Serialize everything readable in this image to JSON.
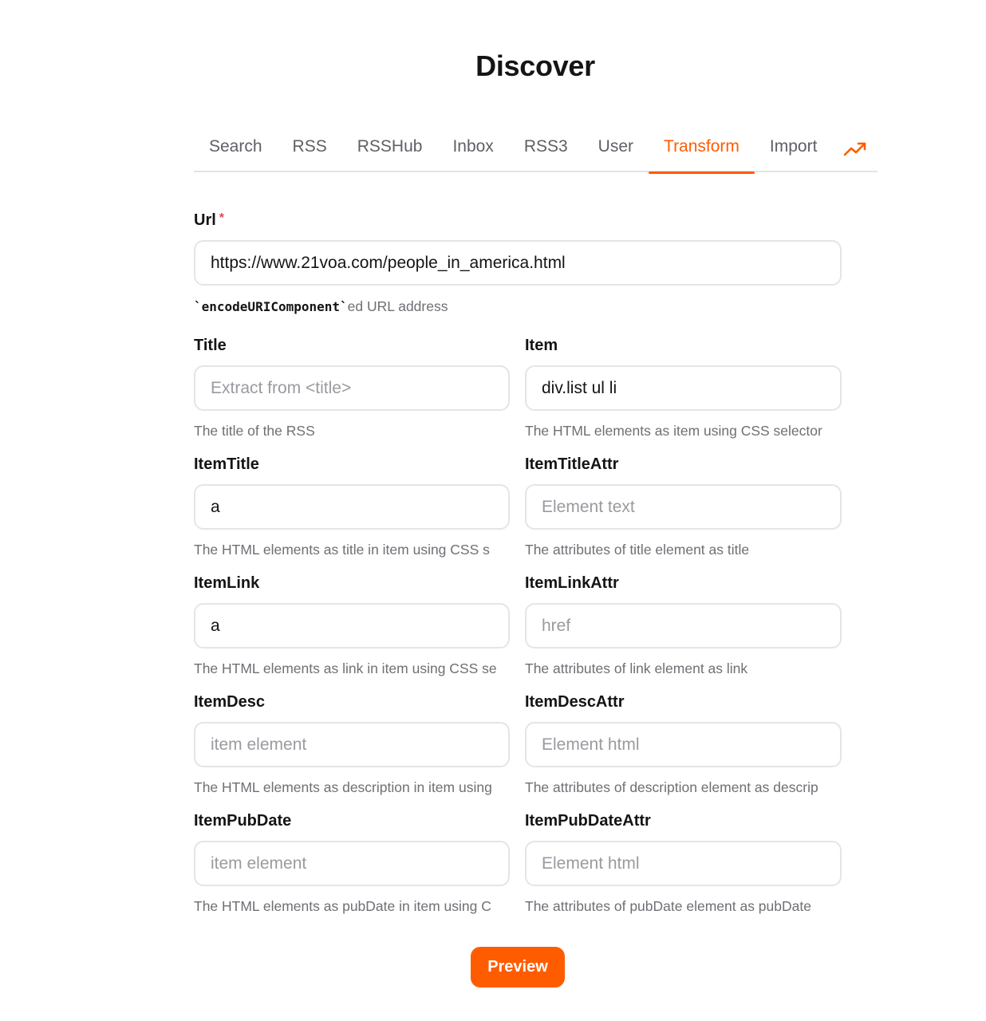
{
  "header": {
    "title": "Discover"
  },
  "tabs": [
    {
      "label": "Search",
      "active": false
    },
    {
      "label": "RSS",
      "active": false
    },
    {
      "label": "RSSHub",
      "active": false
    },
    {
      "label": "Inbox",
      "active": false
    },
    {
      "label": "RSS3",
      "active": false
    },
    {
      "label": "User",
      "active": false
    },
    {
      "label": "Transform",
      "active": true
    },
    {
      "label": "Import",
      "active": false
    }
  ],
  "trending_icon": "trending-up-icon",
  "accent_color": "#ff5c00",
  "form": {
    "url": {
      "label": "Url",
      "required_mark": "*",
      "value": "https://www.21voa.com/people_in_america.html",
      "help_code": "`encodeURIComponent`",
      "help_text": "ed URL address"
    },
    "title": {
      "label": "Title",
      "value": "",
      "placeholder": "Extract from <title>",
      "help": "The title of the RSS"
    },
    "item": {
      "label": "Item",
      "value": "div.list ul li",
      "placeholder": "",
      "help": "The HTML elements as item using CSS selector"
    },
    "item_title": {
      "label": "ItemTitle",
      "value": "a",
      "placeholder": "",
      "help": "The HTML elements as title in item using CSS s"
    },
    "item_title_attr": {
      "label": "ItemTitleAttr",
      "value": "",
      "placeholder": "Element text",
      "help": "The attributes of title element as title"
    },
    "item_link": {
      "label": "ItemLink",
      "value": "a",
      "placeholder": "",
      "help": "The HTML elements as link in item using CSS se"
    },
    "item_link_attr": {
      "label": "ItemLinkAttr",
      "value": "",
      "placeholder": "href",
      "help": "The attributes of link element as link"
    },
    "item_desc": {
      "label": "ItemDesc",
      "value": "",
      "placeholder": "item element",
      "help": "The HTML elements as description in item using"
    },
    "item_desc_attr": {
      "label": "ItemDescAttr",
      "value": "",
      "placeholder": "Element html",
      "help": "The attributes of description element as descrip"
    },
    "item_pubdate": {
      "label": "ItemPubDate",
      "value": "",
      "placeholder": "item element",
      "help": "The HTML elements as pubDate in item using C"
    },
    "item_pubdate_attr": {
      "label": "ItemPubDateAttr",
      "value": "",
      "placeholder": "Element html",
      "help": "The attributes of pubDate element as pubDate"
    }
  },
  "preview_button": {
    "label": "Preview"
  }
}
